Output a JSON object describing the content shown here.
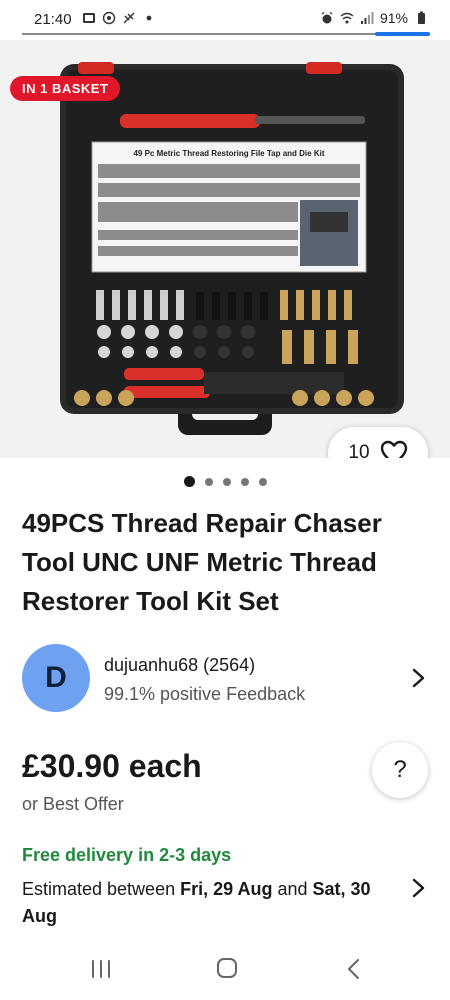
{
  "status_bar": {
    "time": "21:40",
    "battery": "91%"
  },
  "hero": {
    "badge": "IN 1 BASKET",
    "watch_count": "10",
    "kit_label": "49 Pc Metric Thread Restoring File Tap and Die Kit"
  },
  "carousel": {
    "dot_count": 5,
    "active_index": 0
  },
  "listing": {
    "title": "49PCS Thread Repair Chaser Tool UNC UNF Metric Thread Restorer Tool Kit Set"
  },
  "seller": {
    "initial": "D",
    "name": "dujuanhu68 (2564)",
    "feedback": "99.1% positive Feedback"
  },
  "price": {
    "amount": "£30.90 each",
    "best_offer": "or Best Offer",
    "help_label": "?"
  },
  "delivery": {
    "headline": "Free delivery in 2-3 days",
    "estimate_prefix": "Estimated between ",
    "date_from": "Fri, 29 Aug",
    "estimate_join": " and ",
    "date_to": "Sat, 30 Aug"
  },
  "colors": {
    "accent_red": "#e0162b",
    "delivery_green": "#1f8a3c",
    "avatar_blue": "#6ea2f0",
    "progress_blue": "#1a73e8"
  }
}
